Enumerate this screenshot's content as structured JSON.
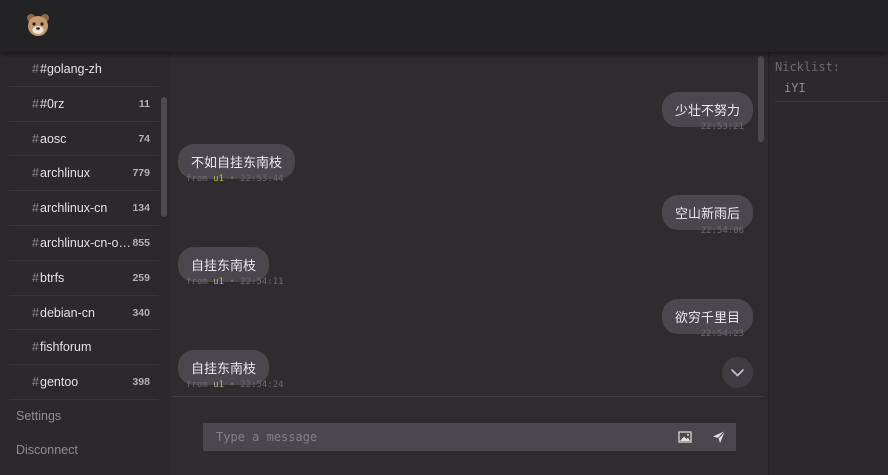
{
  "header": {
    "logo_icon": "bear-logo-icon"
  },
  "sidebar": {
    "channels": [
      {
        "hash": "#",
        "name": "#golang-zh",
        "count": ""
      },
      {
        "hash": "#",
        "name": "#0rz",
        "count": "11"
      },
      {
        "hash": "#",
        "name": "aosc",
        "count": "74"
      },
      {
        "hash": "#",
        "name": "archlinux",
        "count": "779"
      },
      {
        "hash": "#",
        "name": "archlinux-cn",
        "count": "134"
      },
      {
        "hash": "#",
        "name": "archlinux-cn-o…",
        "count": "855"
      },
      {
        "hash": "#",
        "name": "btrfs",
        "count": "259"
      },
      {
        "hash": "#",
        "name": "debian-cn",
        "count": "340"
      },
      {
        "hash": "#",
        "name": "fishforum",
        "count": ""
      },
      {
        "hash": "#",
        "name": "gentoo",
        "count": "398"
      }
    ],
    "settings_label": "Settings",
    "disconnect_label": "Disconnect"
  },
  "messages": [
    {
      "text": "少壮不努力",
      "time": "22:53:21",
      "own": true
    },
    {
      "text": "不如自挂东南枝",
      "from": "from",
      "nick": "u1",
      "sep": "•",
      "time": "22:53:44",
      "own": false
    },
    {
      "text": "空山新雨后",
      "time": "22:54:06",
      "own": true
    },
    {
      "text": "自挂东南枝",
      "from": "from",
      "nick": "u1",
      "sep": "•",
      "time": "22:54:11",
      "own": false
    },
    {
      "text": "欲穷千里目",
      "time": "22:54:23",
      "own": true
    },
    {
      "text": "自挂东南枝",
      "from": "from",
      "nick": "u1",
      "sep": "•",
      "time": "22:54:24",
      "own": false
    }
  ],
  "composer": {
    "placeholder": "Type a message"
  },
  "nicklist": {
    "title": "Nicklist:",
    "nicks": [
      "iYI"
    ]
  },
  "colors": {
    "background": "#2e2c2f",
    "topbar": "#232224",
    "bubble": "#4a484c",
    "nick_highlight": "#b7b94a"
  }
}
